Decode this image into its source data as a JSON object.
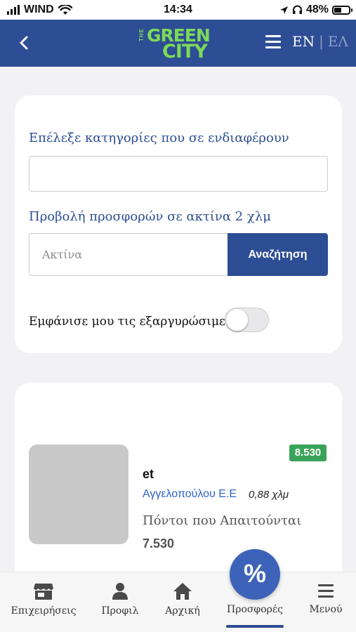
{
  "status_bar": {
    "carrier": "WIND",
    "time": "14:34",
    "battery_percent": "48%",
    "battery_level": 0.48
  },
  "header": {
    "logo_the": "THE",
    "logo_line1": "GREEN",
    "logo_line2": "CITY",
    "lang_en": "EN",
    "lang_sep": "|",
    "lang_el": "ΕΛ"
  },
  "filters": {
    "categories_label": "Επέλεξε κατηγορίες που σε ενδιαφέρουν",
    "categories_value": "",
    "radius_label": "Προβολή προσφορών σε ακτίνα 2 χλμ",
    "radius_placeholder": "Ακτίνα",
    "search_button": "Αναζήτηση",
    "redeemable_label": "Εμφάνισε μου τις εξαργυρώσιμες",
    "redeemable_on": false
  },
  "offer": {
    "badge": "8.530",
    "title": "et",
    "merchant": "Αγγελοπούλου Ε.Ε",
    "distance": "0,88 χλμ",
    "points_label": "Πόντοι που Απαιτούνται",
    "points_value": "7.530"
  },
  "tabs": [
    {
      "label": "Επιχειρήσεις",
      "icon": "store-icon"
    },
    {
      "label": "Προφιλ",
      "icon": "user-icon"
    },
    {
      "label": "Αρχική",
      "icon": "home-icon"
    },
    {
      "label": "Προσφορές",
      "icon": "percent-icon"
    },
    {
      "label": "Μενού",
      "icon": "menu-icon"
    }
  ],
  "fab_symbol": "%",
  "colors": {
    "brand_blue": "#2d4d94",
    "logo_green": "#7dd957",
    "badge_green": "#3aa35a",
    "link_blue": "#2f63c8"
  }
}
